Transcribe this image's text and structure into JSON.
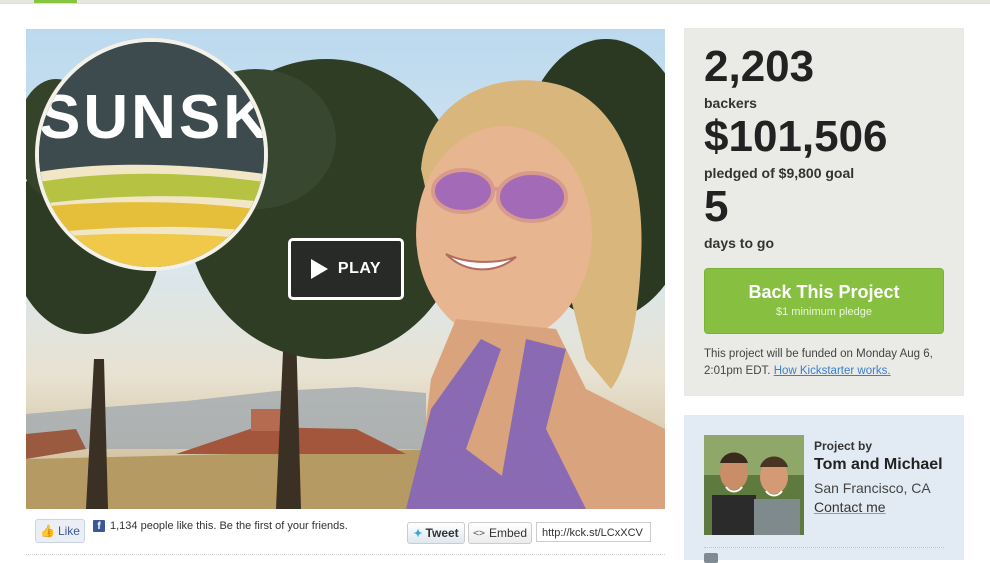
{
  "video": {
    "logo_text": "SUNSKI",
    "play_label": "PLAY"
  },
  "share": {
    "like_label": "Like",
    "fb_count_text": "1,134 people like this. Be the first of your friends.",
    "tweet_label": "Tweet",
    "embed_label": "Embed",
    "short_url": "http://kck.st/LCxXCV"
  },
  "stats": {
    "backers_count": "2,203",
    "backers_label": "backers",
    "pledged_amount": "$101,506",
    "pledged_label": "pledged of $9,800 goal",
    "days_count": "5",
    "days_label": "days to go",
    "back_button_title": "Back This Project",
    "back_button_sub": "$1 minimum pledge",
    "fund_note_prefix": "This project will be funded on Monday Aug 6, 2:01pm EDT.",
    "how_link": "How Kickstarter works."
  },
  "creator": {
    "project_by_label": "Project by",
    "name": "Tom and Michael",
    "location": "San Francisco, CA",
    "contact_label": "Contact me"
  },
  "colors": {
    "accent_green": "#87c040",
    "link_blue": "#3a7fcf",
    "stats_bg": "#eaeae6",
    "creator_bg": "#e2ebf3"
  }
}
